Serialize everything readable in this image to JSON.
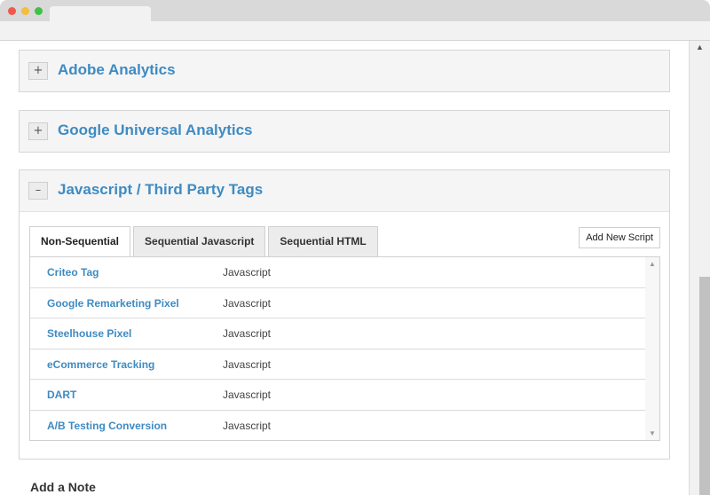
{
  "panels": {
    "adobe": {
      "toggle": "+",
      "title": "Adobe Analytics"
    },
    "google": {
      "toggle": "+",
      "title": "Google Universal Analytics"
    },
    "javascript": {
      "toggle": "–",
      "title": "Javascript / Third Party Tags"
    }
  },
  "tabs": [
    {
      "label": "Non-Sequential",
      "active": true
    },
    {
      "label": "Sequential Javascript",
      "active": false
    },
    {
      "label": "Sequential HTML",
      "active": false
    }
  ],
  "add_button": "Add New Script",
  "scripts": [
    {
      "name": "Criteo Tag",
      "type": "Javascript"
    },
    {
      "name": "Google Remarketing Pixel",
      "type": "Javascript"
    },
    {
      "name": "Steelhouse Pixel",
      "type": "Javascript"
    },
    {
      "name": "eCommerce Tracking",
      "type": "Javascript"
    },
    {
      "name": "DART",
      "type": "Javascript"
    },
    {
      "name": "A/B Testing Conversion",
      "type": "Javascript"
    }
  ],
  "note_heading": "Add a Note",
  "icons": {
    "scroll_up": "▲",
    "scroll_down": "▼"
  },
  "colors": {
    "link": "#3e8bc2"
  }
}
